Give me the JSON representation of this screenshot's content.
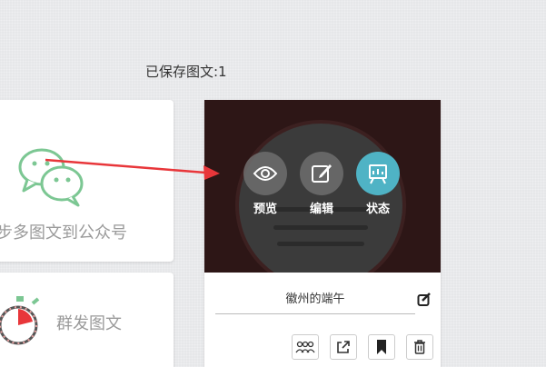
{
  "saved_count": "已保存图文:1",
  "sync_card": {
    "label": "步多图文到公众号",
    "icon": "wechat-icon"
  },
  "mass_card": {
    "label": "群发图文",
    "icon": "timer-icon"
  },
  "article": {
    "title": "徽州的端午",
    "actions": [
      {
        "label": "预览",
        "icon": "eye-icon"
      },
      {
        "label": "编辑",
        "icon": "edit-icon"
      },
      {
        "label": "状态",
        "icon": "status-icon"
      }
    ],
    "tools": [
      "users-icon",
      "share-icon",
      "bookmark-icon",
      "trash-icon"
    ]
  },
  "colors": {
    "accent": "#4fb3c5",
    "arrow": "#e8363a",
    "wechat": "#7cc793"
  }
}
